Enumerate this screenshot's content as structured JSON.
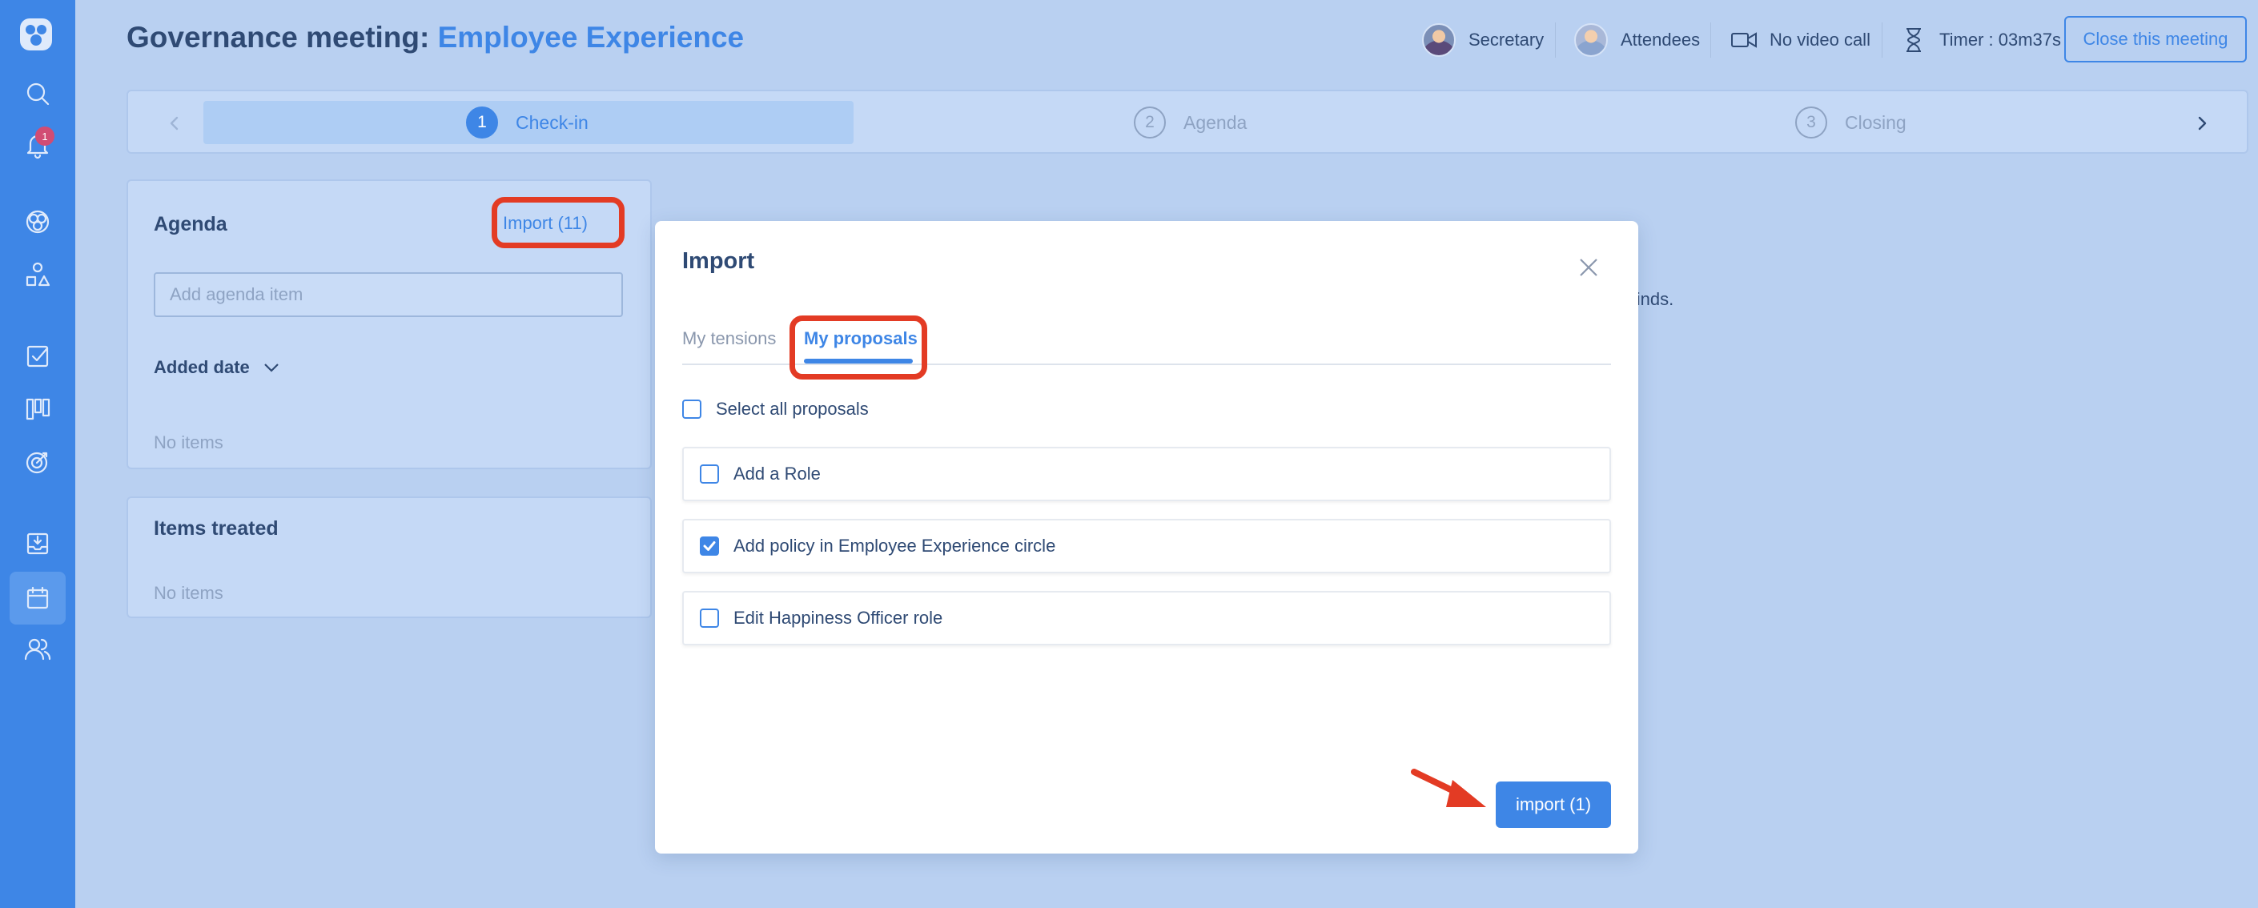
{
  "header": {
    "title_prefix": "Governance meeting: ",
    "title_circle": "Employee Experience",
    "secretary": "Secretary",
    "attendees": "Attendees",
    "video": "No video call",
    "timer": "Timer : 03m37s",
    "close_button": "Close this meeting"
  },
  "sidebar": {
    "notification_count": "1",
    "icons": [
      "logo-icon",
      "search-icon",
      "bell-icon",
      "circle-icon",
      "shapes-icon",
      "checklist-icon",
      "kanban-icon",
      "target-icon",
      "inbox-icon",
      "calendar-icon",
      "users-icon"
    ]
  },
  "stepper": {
    "steps": [
      {
        "num": "1",
        "label": "Check-in",
        "state": "current"
      },
      {
        "num": "2",
        "label": "Agenda",
        "state": "upcoming"
      },
      {
        "num": "3",
        "label": "Closing",
        "state": "upcoming"
      }
    ]
  },
  "agenda_panel": {
    "title": "Agenda",
    "import_link": "Import (11)",
    "input_placeholder": "Add agenda item",
    "sort_label": "Added date",
    "empty": "No items"
  },
  "treated_panel": {
    "title": "Items treated",
    "empty": "No items"
  },
  "background_text": "r minds.",
  "modal": {
    "title": "Import",
    "tabs": [
      "My tensions",
      "My proposals"
    ],
    "active_tab": "My proposals",
    "select_all_label": "Select all proposals",
    "select_all_checked": false,
    "items": [
      {
        "label": "Add a Role",
        "checked": false
      },
      {
        "label": "Add policy in Employee Experience circle",
        "checked": true
      },
      {
        "label": "Edit Happiness Officer role",
        "checked": false
      }
    ],
    "import_button": "import (1)"
  },
  "colors": {
    "accent": "#3e86e6",
    "highlight": "#e33b24",
    "backdrop": "#b9d0f1",
    "sidebar": "#3e86e6"
  }
}
